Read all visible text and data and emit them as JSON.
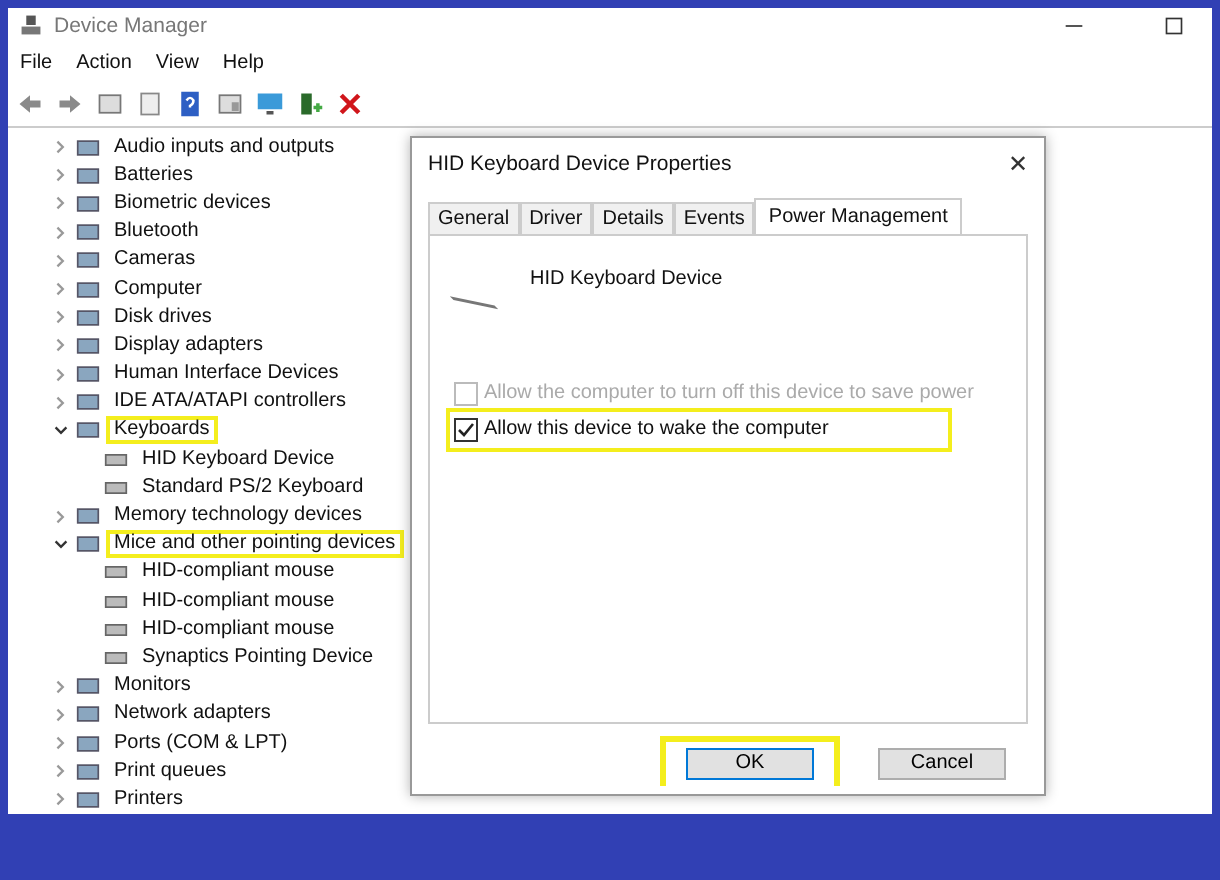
{
  "window": {
    "title": "Device Manager"
  },
  "menu": [
    "File",
    "Action",
    "View",
    "Help"
  ],
  "tree": [
    {
      "label": "Audio inputs and outputs",
      "expanded": false,
      "highlighted": false
    },
    {
      "label": "Batteries",
      "expanded": false,
      "highlighted": false
    },
    {
      "label": "Biometric devices",
      "expanded": false,
      "highlighted": false
    },
    {
      "label": "Bluetooth",
      "expanded": false,
      "highlighted": false
    },
    {
      "label": "Cameras",
      "expanded": false,
      "highlighted": false
    },
    {
      "label": "Computer",
      "expanded": false,
      "highlighted": false
    },
    {
      "label": "Disk drives",
      "expanded": false,
      "highlighted": false
    },
    {
      "label": "Display adapters",
      "expanded": false,
      "highlighted": false
    },
    {
      "label": "Human Interface Devices",
      "expanded": false,
      "highlighted": false
    },
    {
      "label": "IDE ATA/ATAPI controllers",
      "expanded": false,
      "highlighted": false
    },
    {
      "label": "Keyboards",
      "expanded": true,
      "highlighted": true,
      "children": [
        {
          "label": "HID Keyboard Device"
        },
        {
          "label": "Standard PS/2 Keyboard"
        }
      ]
    },
    {
      "label": "Memory technology devices",
      "expanded": false,
      "highlighted": false
    },
    {
      "label": "Mice and other pointing devices",
      "expanded": true,
      "highlighted": true,
      "children": [
        {
          "label": "HID-compliant mouse"
        },
        {
          "label": "HID-compliant mouse"
        },
        {
          "label": "HID-compliant mouse"
        },
        {
          "label": "Synaptics Pointing Device"
        }
      ]
    },
    {
      "label": "Monitors",
      "expanded": false,
      "highlighted": false
    },
    {
      "label": "Network adapters",
      "expanded": false,
      "highlighted": false
    },
    {
      "label": "Ports (COM & LPT)",
      "expanded": false,
      "highlighted": false
    },
    {
      "label": "Print queues",
      "expanded": false,
      "highlighted": false
    },
    {
      "label": "Printers",
      "expanded": false,
      "highlighted": false
    }
  ],
  "dialog": {
    "title": "HID Keyboard Device Properties",
    "close": "✕",
    "tabs": [
      {
        "label": "General",
        "selected": false
      },
      {
        "label": "Driver",
        "selected": false
      },
      {
        "label": "Details",
        "selected": false
      },
      {
        "label": "Events",
        "selected": false
      },
      {
        "label": "Power Management",
        "selected": true
      }
    ],
    "device_name": "HID Keyboard Device",
    "options": [
      {
        "label": "Allow the computer to turn off this device to save power",
        "checked": false,
        "disabled": true,
        "highlighted": false
      },
      {
        "label": "Allow this device to wake the computer",
        "checked": true,
        "disabled": false,
        "highlighted": true
      }
    ],
    "buttons": [
      {
        "label": "OK",
        "highlighted": true
      },
      {
        "label": "Cancel",
        "highlighted": false
      }
    ]
  }
}
